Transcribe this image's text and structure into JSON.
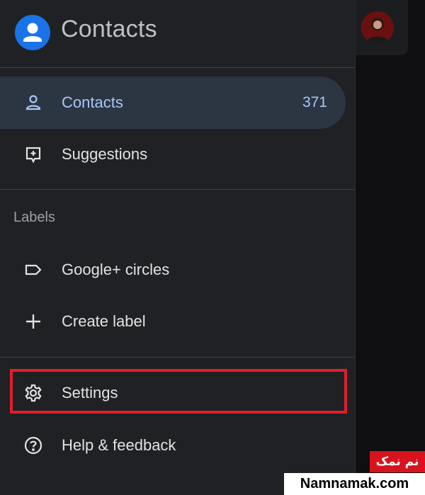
{
  "app": {
    "title": "Contacts"
  },
  "nav": {
    "contacts": {
      "label": "Contacts",
      "count": "371"
    },
    "suggestions": {
      "label": "Suggestions"
    }
  },
  "labels_section": {
    "heading": "Labels",
    "items": [
      {
        "label": "Google+ circles"
      },
      {
        "label": "Create label"
      }
    ]
  },
  "footer_nav": {
    "settings": {
      "label": "Settings"
    },
    "help": {
      "label": "Help & feedback"
    }
  },
  "watermark": {
    "persian": "نم نمک",
    "site": "Namnamak.com"
  },
  "colors": {
    "accent": "#a8c7fa",
    "brand_blue": "#1a73e8",
    "highlight_red": "#e01e2b"
  }
}
